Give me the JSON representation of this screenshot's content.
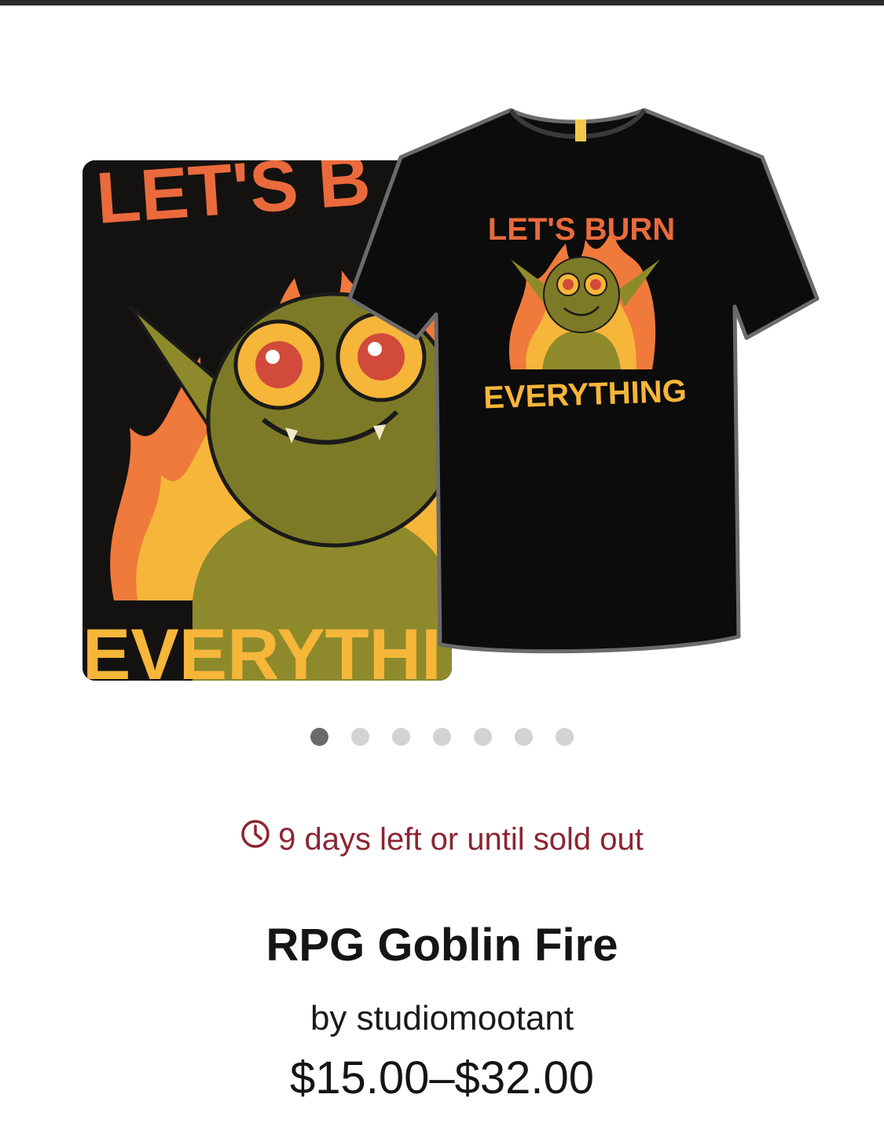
{
  "gallery": {
    "art_label_top": "LET'S B",
    "art_label_bottom": "EVERYTHI",
    "shirt_label_top": "LET'S BURN",
    "shirt_label_bottom": "EVERYTHING",
    "slide_count": 7,
    "active_slide": 1
  },
  "deadline": {
    "icon": "clock-icon",
    "text": "9 days left or until sold out",
    "color": "#8c2430"
  },
  "product": {
    "title": "RPG Goblin Fire",
    "artist": "by studiomootant",
    "price": "$15.00–$32.00"
  }
}
